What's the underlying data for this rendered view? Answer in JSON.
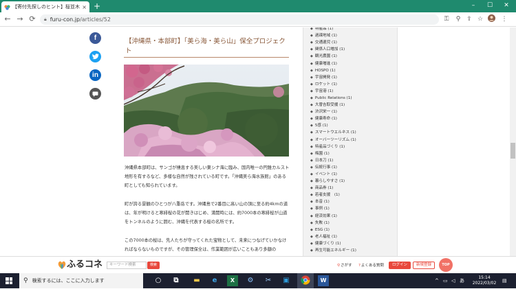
{
  "browser": {
    "tab_title": "【寄付先探しのヒント】桜並木を未来へ",
    "tab_close": "×",
    "new_tab": "+",
    "win_minimize": "–",
    "win_maximize": "☐",
    "win_close": "✕",
    "url_domain": "furu-con.jp",
    "url_path": "/articles/52",
    "back_icon": "←",
    "forward_icon": "→",
    "reload_icon": "⟳"
  },
  "article": {
    "title": "【沖縄県・本部町】「美ら海・美ら山」保全プロジェクト",
    "paragraphs": [
      "沖縄県本部町は、サンゴが棲息する美しい東シナ海に臨み、国内唯一の円錐カルスト地形を有するなど、多様な自然が残されている町です。「沖縄美ら海水族館」のある町としても知られています。",
      "町が誇る景観のひとつが八重岳です。沖縄島で2番目に高い山の頂に至る約4kmの道は、年が明けると寒緋桜の花が開きはじめ、満開時には、約7000本の寒緋桜が山道をトンネルのように囲む、沖縄を代表する桜の名所です。",
      "この7000本の桜は、先人たちが守ってくれた宝物として、未来につなげていかなければならないものですが、その管理保全は、作業範囲が広いこともあり多額の"
    ]
  },
  "sidebar": {
    "tags": [
      "特産品 (1)",
      "過疎地域 (1)",
      "交通遺児 (1)",
      "関係人口増加 (1)",
      "観光農園 (1)",
      "健康増進 (1)",
      "HOSPO (1)",
      "宇宙開発 (1)",
      "ロケット (1)",
      "宇宙港 (1)",
      "Public Relations (1)",
      "大曽吉取受援 (1)",
      "渋沢栄一 (1)",
      "健康寿命 (1)",
      "5感 (1)",
      "スマートウエルネス (1)",
      "オーバーツーリズム (1)",
      "特産品づくり (1)",
      "梅園 (1)",
      "日本刀 (1)",
      "伝統行事 (1)",
      "イベント (1)",
      "暮らしやすさ (1)",
      "商品券 (1)",
      "若者支援　(1)",
      "本音 (1)",
      "事例 (1)",
      "経済効果 (1)",
      "失敗 (1)",
      "ESG (1)",
      "老人福祉 (1)",
      "健康づくり (1)",
      "再生可能エネルギー (1)"
    ]
  },
  "footer": {
    "logo": "ふるコネ",
    "keyword_placeholder": "キーワード検索",
    "keyword_button": "検索",
    "nav_search": "さがす",
    "nav_faq": "よくある質問",
    "login": "ログイン",
    "register": "新規登録",
    "top": "TOP"
  },
  "taskbar": {
    "search_text": "検索するには、ここに入力します",
    "time": "15:14",
    "date": "2022/03/02",
    "ime": "あ"
  },
  "colors": {
    "accent": "#e8483c",
    "title_brown": "#8a5a3b",
    "tabbar": "#1f8a6e",
    "facebook": "#3b5998",
    "twitter": "#1da1f2",
    "linkedin": "#0a66c2",
    "comment": "#555555"
  },
  "icons": {
    "share": [
      "facebook-icon",
      "twitter-icon",
      "linkedin-icon",
      "comment-icon"
    ],
    "tag": "tag-icon"
  }
}
